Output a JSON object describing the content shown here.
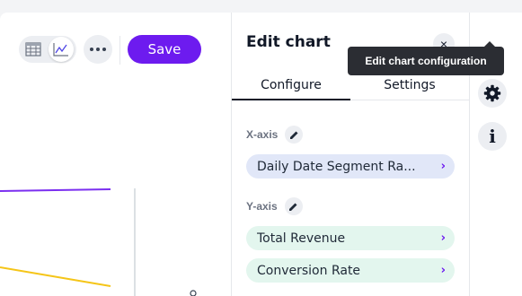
{
  "toolbar": {
    "table_view_icon": "table-icon",
    "chart_view_icon": "line-chart-icon",
    "more_icon": "more-horizontal-icon",
    "save_label": "Save"
  },
  "chart": {
    "series_colors": [
      "#7b2ff0",
      "#f5c518"
    ]
  },
  "panel": {
    "title": "Edit chart",
    "close_glyph": "×",
    "tabs": [
      {
        "label": "Configure",
        "active": true
      },
      {
        "label": "Settings",
        "active": false
      }
    ],
    "x_axis": {
      "label": "X-axis",
      "fields": [
        {
          "label": "Daily Date Segment Ra...",
          "chevron": "›"
        }
      ]
    },
    "y_axis": {
      "label": "Y-axis",
      "fields": [
        {
          "label": "Total Revenue",
          "chevron": "›"
        },
        {
          "label": "Conversion Rate",
          "chevron": "›"
        }
      ]
    }
  },
  "rail": {
    "buttons": [
      "settings-icon",
      "info-icon"
    ],
    "info_glyph": "i"
  },
  "tooltip": {
    "text": "Edit chart configuration"
  },
  "colors": {
    "accent": "#6d1bef",
    "x_pill_bg": "#e1e7f8",
    "y_pill_bg": "#e3f6ee",
    "tooltip_bg": "#2b2d33"
  }
}
